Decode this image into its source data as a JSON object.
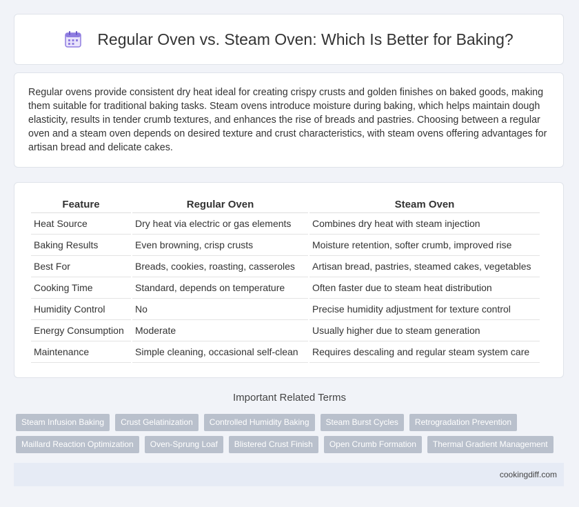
{
  "header": {
    "title": "Regular Oven vs. Steam Oven: Which Is Better for Baking?",
    "icon": "calendar-icon"
  },
  "intro": {
    "text": "Regular ovens provide consistent dry heat ideal for creating crispy crusts and golden finishes on baked goods, making them suitable for traditional baking tasks. Steam ovens introduce moisture during baking, which helps maintain dough elasticity, results in tender crumb textures, and enhances the rise of breads and pastries. Choosing between a regular oven and a steam oven depends on desired texture and crust characteristics, with steam ovens offering advantages for artisan bread and delicate cakes."
  },
  "table": {
    "headers": [
      "Feature",
      "Regular Oven",
      "Steam Oven"
    ],
    "rows": [
      [
        "Heat Source",
        "Dry heat via electric or gas elements",
        "Combines dry heat with steam injection"
      ],
      [
        "Baking Results",
        "Even browning, crisp crusts",
        "Moisture retention, softer crumb, improved rise"
      ],
      [
        "Best For",
        "Breads, cookies, roasting, casseroles",
        "Artisan bread, pastries, steamed cakes, vegetables"
      ],
      [
        "Cooking Time",
        "Standard, depends on temperature",
        "Often faster due to steam heat distribution"
      ],
      [
        "Humidity Control",
        "No",
        "Precise humidity adjustment for texture control"
      ],
      [
        "Energy Consumption",
        "Moderate",
        "Usually higher due to steam generation"
      ],
      [
        "Maintenance",
        "Simple cleaning, occasional self-clean",
        "Requires descaling and regular steam system care"
      ]
    ]
  },
  "related": {
    "title": "Important Related Terms",
    "tags_row1": [
      "Steam Infusion Baking",
      "Crust Gelatinization",
      "Controlled Humidity Baking",
      "Steam Burst Cycles",
      "Retrogradation Prevention"
    ],
    "tags_row2": [
      "Maillard Reaction Optimization",
      "Oven-Sprung Loaf",
      "Blistered Crust Finish",
      "Open Crumb Formation",
      "Thermal Gradient Management"
    ]
  },
  "footer": {
    "site": "cookingdiff.com"
  },
  "colors": {
    "background": "#f1f3f8",
    "tag": "#b9c0cc",
    "footer": "#e6ebf5",
    "icon": "#8f7de0"
  }
}
